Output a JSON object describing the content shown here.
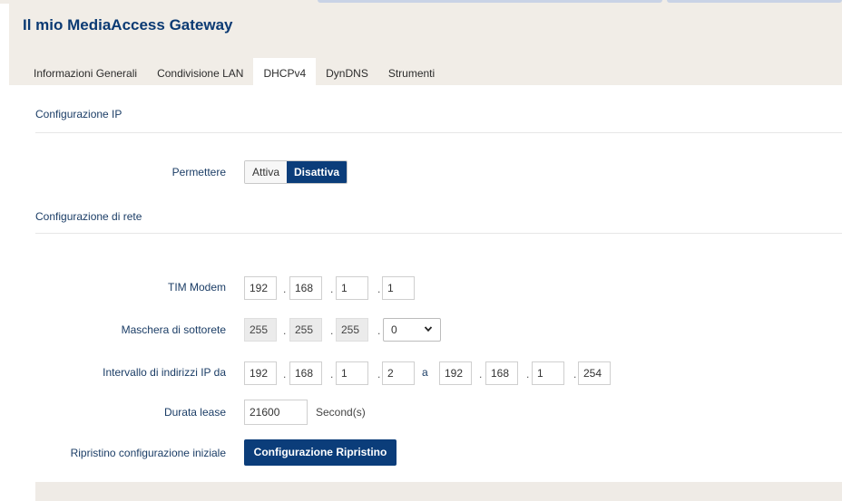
{
  "header": {
    "title": "Il mio MediaAccess Gateway"
  },
  "tabs": [
    {
      "label": "Informazioni Generali",
      "active": false
    },
    {
      "label": "Condivisione LAN",
      "active": false
    },
    {
      "label": "DHCPv4",
      "active": true
    },
    {
      "label": "DynDNS",
      "active": false
    },
    {
      "label": "Strumenti",
      "active": false
    }
  ],
  "ip_config": {
    "title": "Configurazione IP",
    "permit_label": "Permettere",
    "options": [
      "Attiva",
      "Disattiva"
    ],
    "selected": "Disattiva"
  },
  "network_config": {
    "title": "Configurazione di rete",
    "modem": {
      "label": "TIM Modem",
      "octets": [
        "192",
        "168",
        "1",
        "1"
      ]
    },
    "subnet_mask": {
      "label": "Maschera di sottorete",
      "octets": [
        "255",
        "255",
        "255"
      ],
      "last_octet_selected": "0"
    },
    "ip_range": {
      "label": "Intervallo di indirizzi IP da",
      "start_octets": [
        "192",
        "168",
        "1",
        "2"
      ],
      "separator": "a",
      "end_octets": [
        "192",
        "168",
        "1",
        "254"
      ]
    },
    "lease": {
      "label": "Durata lease",
      "value": "21600",
      "unit": "Second(s)"
    },
    "restore": {
      "label": "Ripristino configurazione iniziale",
      "button": "Configurazione Ripristino"
    }
  },
  "colors": {
    "brand_navy": "#0b3a73",
    "primary_button": "#0b3d7a",
    "header_background": "#f1ede7",
    "label_text": "#1b3d66"
  },
  "icons": {
    "select_arrow": "chevron-down-icon"
  }
}
